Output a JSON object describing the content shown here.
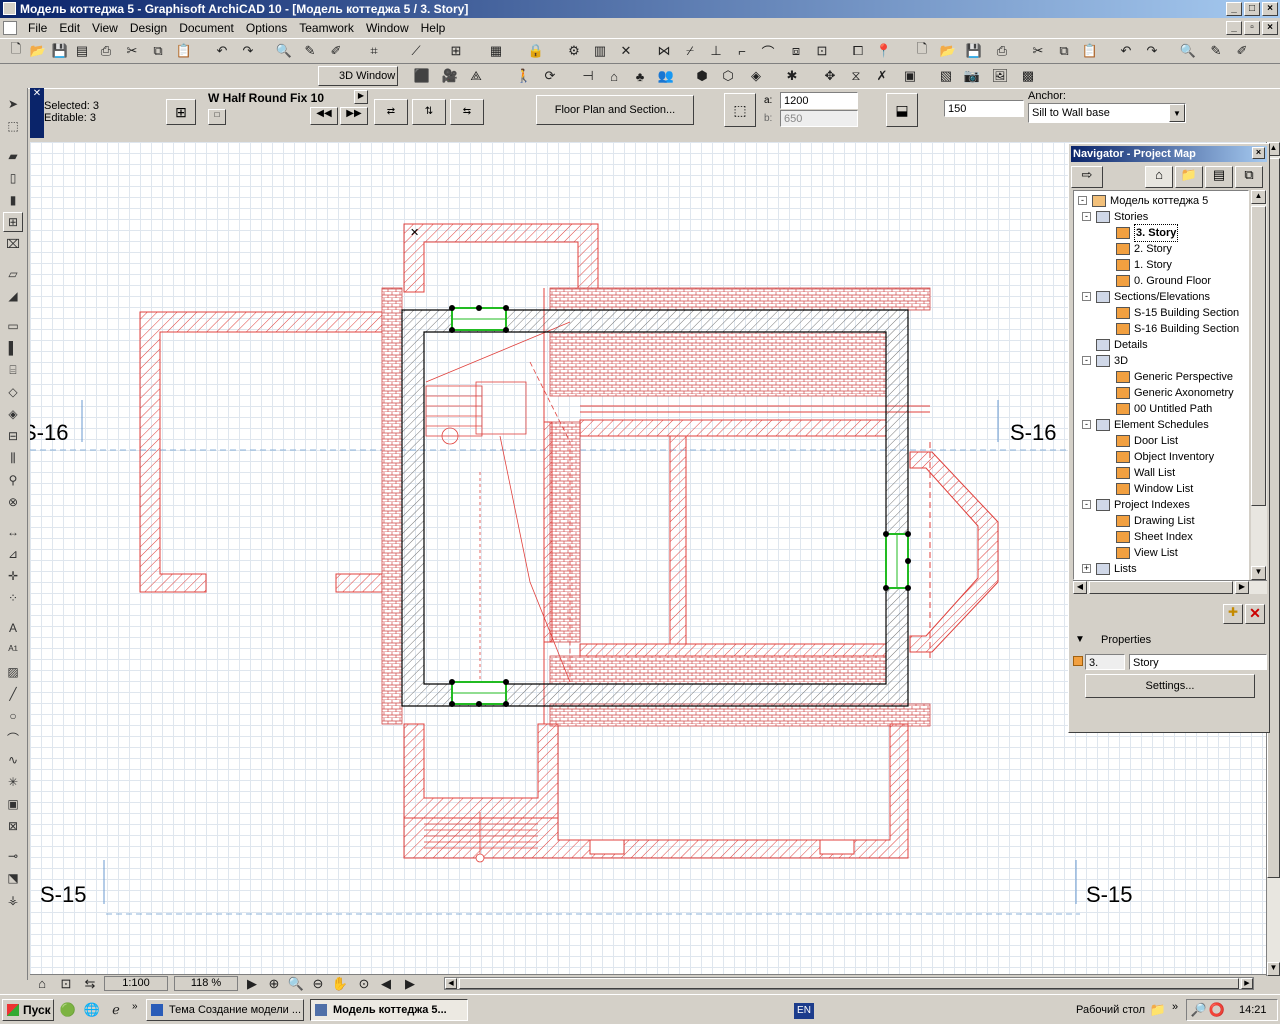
{
  "window": {
    "title": "Модель коттеджа 5 - Graphisoft ArchiCAD 10 - [Модель коттеджа 5 / 3. Story]"
  },
  "menu": [
    "File",
    "Edit",
    "View",
    "Design",
    "Document",
    "Options",
    "Teamwork",
    "Window",
    "Help"
  ],
  "toolbar2": {
    "window_3d_label": "3D Window"
  },
  "infobox": {
    "selected_label": "Selected: 3",
    "editable_label": "Editable: 3",
    "object_name": "W Half Round Fix 10",
    "view_button": "Floor Plan and Section...",
    "a_label": "a:",
    "a_value": "1200",
    "b_label": "b:",
    "b_value": "650",
    "height_value": "150",
    "anchor_label": "Anchor:",
    "anchor_value": "Sill to Wall base"
  },
  "navigator": {
    "title": "Navigator - Project Map",
    "project": "Модель коттеджа 5",
    "tree": [
      {
        "label": "Stories",
        "level": 1,
        "expander": "-"
      },
      {
        "label": "3. Story",
        "level": 2,
        "selected": true
      },
      {
        "label": "2. Story",
        "level": 2
      },
      {
        "label": "1. Story",
        "level": 2
      },
      {
        "label": "0. Ground Floor",
        "level": 2
      },
      {
        "label": "Sections/Elevations",
        "level": 1,
        "expander": "-"
      },
      {
        "label": "S-15 Building Section",
        "level": 2
      },
      {
        "label": "S-16 Building Section",
        "level": 2
      },
      {
        "label": "Details",
        "level": 1
      },
      {
        "label": "3D",
        "level": 1,
        "expander": "-"
      },
      {
        "label": "Generic Perspective",
        "level": 2
      },
      {
        "label": "Generic Axonometry",
        "level": 2
      },
      {
        "label": "00 Untitled Path",
        "level": 2
      },
      {
        "label": "Element Schedules",
        "level": 1,
        "expander": "-"
      },
      {
        "label": "Door List",
        "level": 2
      },
      {
        "label": "Object Inventory",
        "level": 2
      },
      {
        "label": "Wall List",
        "level": 2
      },
      {
        "label": "Window List",
        "level": 2
      },
      {
        "label": "Project Indexes",
        "level": 1,
        "expander": "-"
      },
      {
        "label": "Drawing List",
        "level": 2
      },
      {
        "label": "Sheet Index",
        "level": 2
      },
      {
        "label": "View List",
        "level": 2
      },
      {
        "label": "Lists",
        "level": 1,
        "expander": "+"
      }
    ],
    "properties_label": "Properties",
    "prop_number": "3.",
    "prop_name": "Story",
    "settings_button": "Settings..."
  },
  "drawing": {
    "section_labels": {
      "s16_left": "S-16",
      "s16_right": "S-16",
      "s15_left": "S-15",
      "s15_right": "S-15"
    },
    "colors": {
      "walls": "#000000",
      "hatch_red": "#e0403c",
      "selection": "#22bb22"
    }
  },
  "status": {
    "scale": "1:100",
    "zoom": "118 %"
  },
  "taskbar": {
    "start": "Пуск",
    "task1": "Тема Создание модели ...",
    "task2": "Модель коттеджа 5...",
    "lang": "EN",
    "desktop": "Рабочий стол",
    "time": "14:21"
  }
}
